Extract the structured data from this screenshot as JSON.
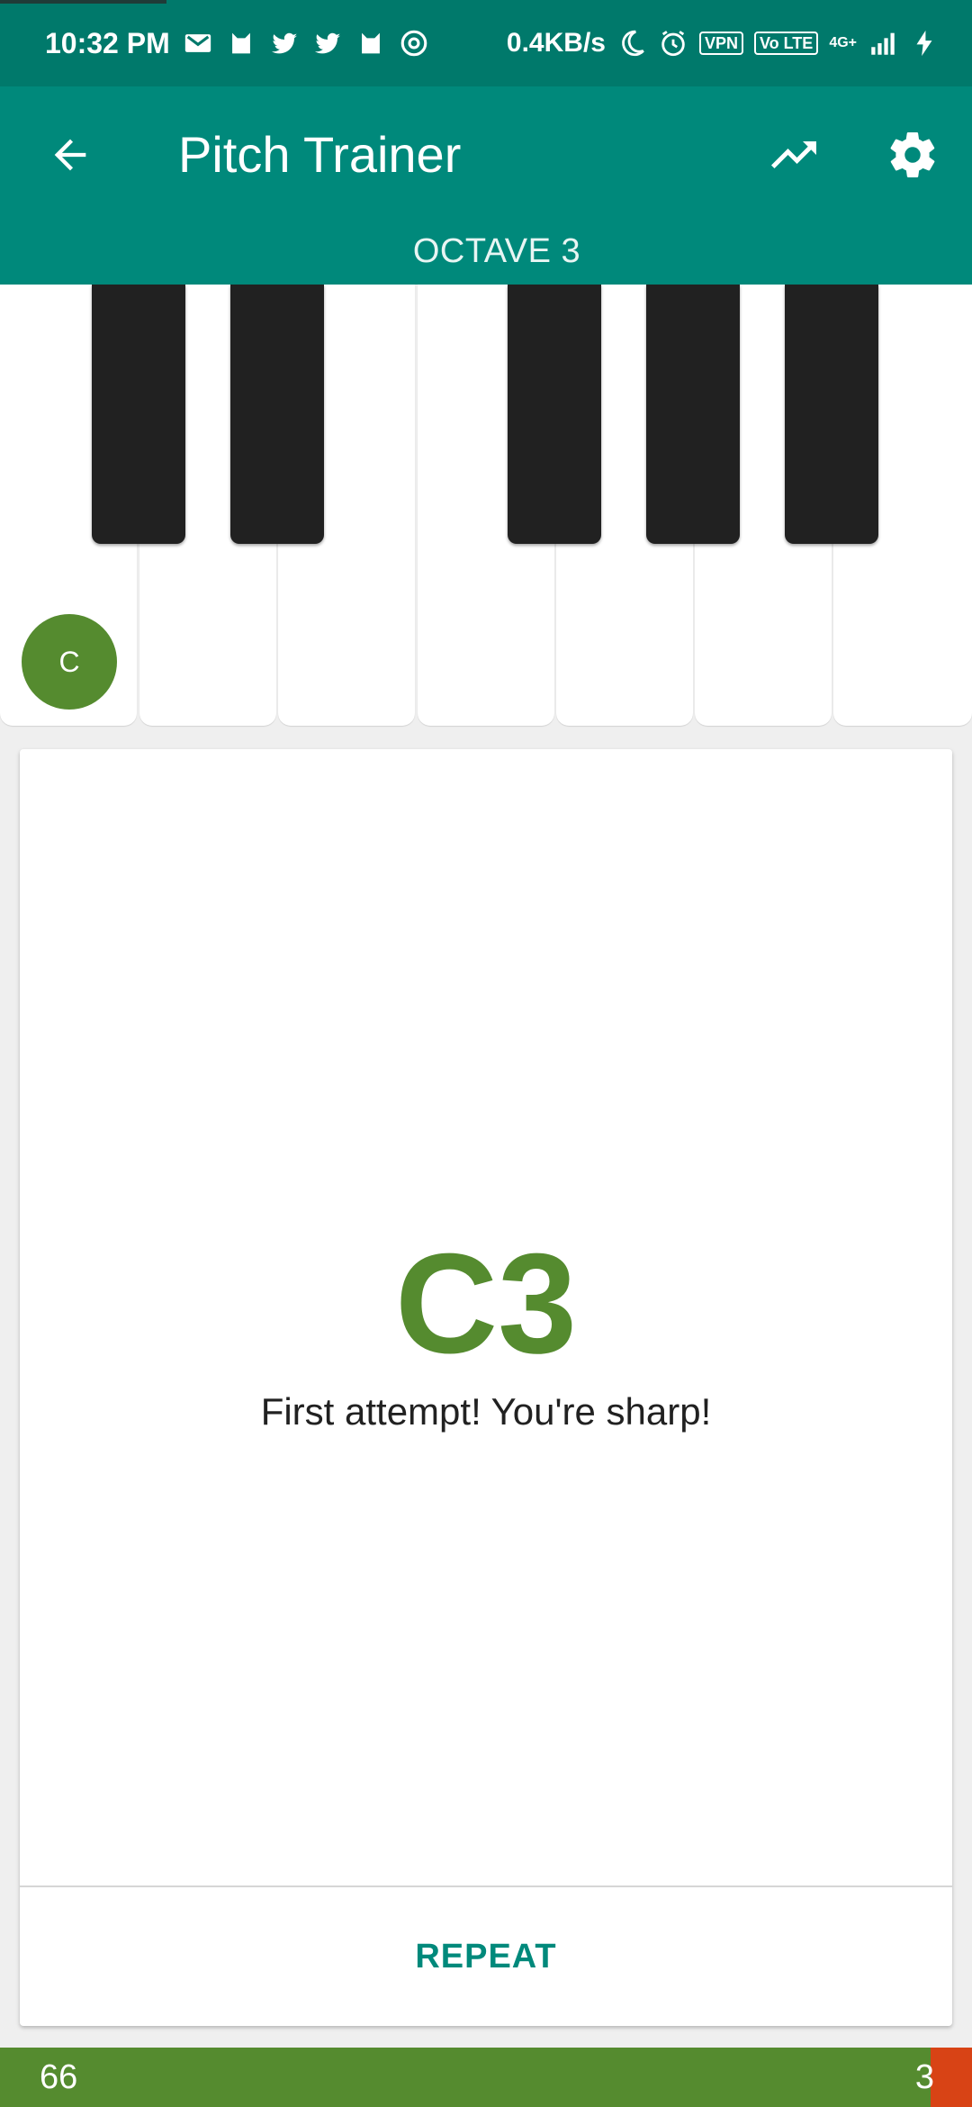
{
  "status_bar": {
    "time": "10:32 PM",
    "network_speed": "0.4KB/s",
    "vpn_label": "VPN",
    "volte_label": "Vo LTE",
    "signal_label": "4G+",
    "notification_icons": [
      "gmail-icon",
      "cat-icon",
      "twitter-icon",
      "twitter-icon",
      "cat-icon",
      "chrome-icon"
    ],
    "system_icons": [
      "moon-icon",
      "alarm-icon",
      "vpn-icon",
      "volte-icon",
      "signal-icon",
      "charging-icon"
    ]
  },
  "app_bar": {
    "title": "Pitch Trainer",
    "subtitle": "OCTAVE 3",
    "background": "#00897b",
    "icons": [
      "back-arrow-icon",
      "trending-up-icon",
      "gear-icon"
    ]
  },
  "keyboard": {
    "white_keys": 7,
    "black_keys": 5,
    "highlighted_note_label": "C",
    "highlight_color": "#558b2f"
  },
  "result_card": {
    "note": "C3",
    "message": "First attempt! You're sharp!",
    "repeat_label": "REPEAT",
    "accent_color": "#558b2f",
    "button_color": "#00897b"
  },
  "score_bar": {
    "correct": "66",
    "wrong": "3",
    "correct_color": "#558b2f",
    "wrong_color": "#d84315"
  }
}
